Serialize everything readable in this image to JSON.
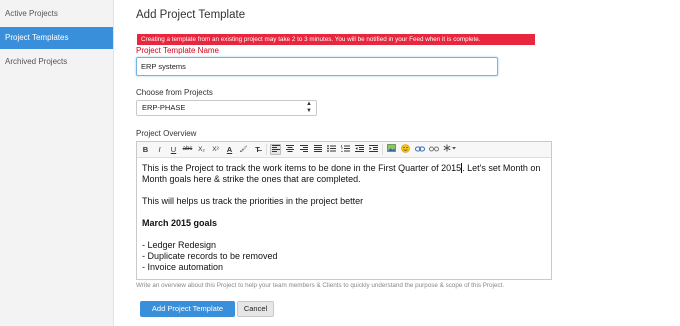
{
  "sidebar": {
    "items": [
      {
        "label": "Active Projects"
      },
      {
        "label": "Project Templates",
        "active": true
      },
      {
        "label": "Archived Projects"
      }
    ]
  },
  "page": {
    "title": "Add Project Template",
    "alert": "Creating a template from an existing project may take 2 to 3 minutes. You will be notified in your Feed when it is complete.",
    "template_name_label": "Project Template Name",
    "template_name_value": "ERP systems",
    "choose_label": "Choose from Projects",
    "choose_value": "ERP-PHASE",
    "overview_label": "Project Overview",
    "hint": "Write an overview about this Project to help your team members & Clients to quickly understand the purpose & scope of this Project."
  },
  "editor": {
    "toolbar": {
      "bold": "B",
      "italic": "I",
      "underline": "U",
      "strike": "abc",
      "subscript": "X₂",
      "superscript": "X²",
      "font_color": "A",
      "bg_color": "🖌",
      "clear_format": "T̶",
      "image": "🖼",
      "emoji": "☺",
      "link": "🔗",
      "unlink": "⊘",
      "more": "✱▾"
    },
    "lines": [
      "This is the Project to track the work items to be done in the First Quarter of 2015. Let's set Month on Month goals here & strike the ones that are completed.",
      "This will helps us track the priorities in the project better",
      "March 2015 goals",
      "- Ledger Redesign",
      "- Duplicate records to be removed",
      "- Invoice automation"
    ]
  },
  "buttons": {
    "add": "Add Project Template",
    "cancel": "Cancel"
  },
  "colors": {
    "accent": "#3a8fdb",
    "alert": "#e8263d",
    "error_label": "#d0021b"
  }
}
